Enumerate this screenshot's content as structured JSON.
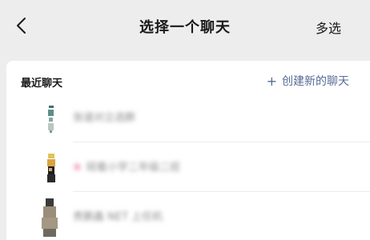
{
  "topbar": {
    "back_icon": "chevron-left-icon",
    "title": "选择一个聊天",
    "multi_select": "多选"
  },
  "recent": {
    "section_title": "最近聊天",
    "create_plus": "+",
    "create_label": "创建新的聊天"
  },
  "chats": [
    {
      "name": "张道对立选群"
    },
    {
      "name": "砚着小学二年级二班",
      "icon": "heart-icon"
    },
    {
      "name": "贵鹏鑫 NET 上任机"
    }
  ]
}
